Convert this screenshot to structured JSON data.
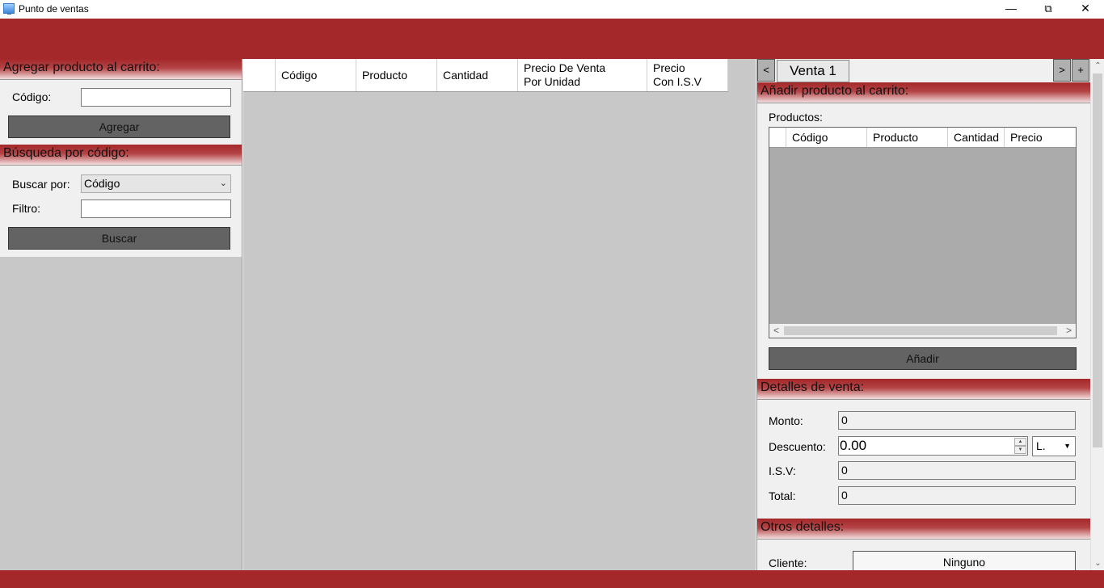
{
  "window": {
    "title": "Punto de ventas",
    "minimize": "—",
    "maximize": "⧉",
    "close": "✕"
  },
  "left": {
    "add_section": {
      "header": "Agregar producto al carrito:",
      "code_label": "Código:",
      "code_value": "",
      "add_button": "Agregar"
    },
    "search_section": {
      "header": "Búsqueda por código:",
      "search_by_label": "Buscar por:",
      "search_by_value": "Código",
      "filter_label": "Filtro:",
      "filter_value": "",
      "search_button": "Buscar"
    }
  },
  "cart_grid": {
    "columns": [
      "Código",
      "Producto",
      "Cantidad",
      "Precio De Venta\nPor Unidad",
      "Precio\nCon I.S.V"
    ],
    "rows": []
  },
  "right": {
    "tabs": {
      "prev": "<",
      "next": ">",
      "add": "+",
      "active_tab": "Venta 1"
    },
    "add_product": {
      "header": "Añadir producto al carrito:",
      "products_label": "Productos:",
      "columns": [
        "Código",
        "Producto",
        "Cantidad",
        "Precio"
      ],
      "scroll_left": "<",
      "scroll_right": ">",
      "add_button": "Añadir"
    },
    "sale_details": {
      "header": "Detalles de venta:",
      "amount_label": "Monto:",
      "amount_value": "0",
      "discount_label": "Descuento:",
      "discount_value": "0.00",
      "currency_value": "L.",
      "tax_label": "I.S.V:",
      "tax_value": "0",
      "total_label": "Total:",
      "total_value": "0"
    },
    "other_details": {
      "header": "Otros detalles:",
      "client_label": "Cliente:",
      "client_button": "Ninguno"
    }
  }
}
